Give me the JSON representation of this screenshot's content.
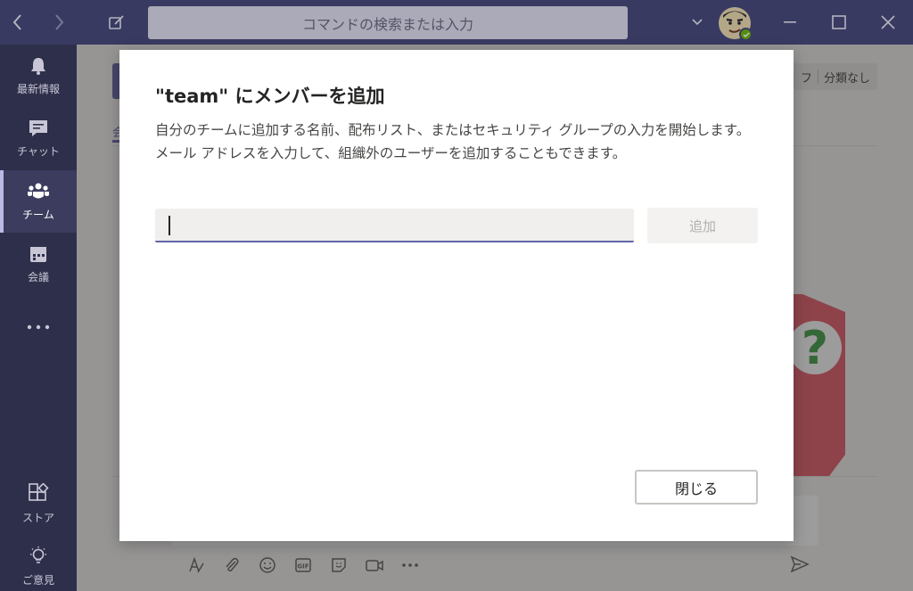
{
  "titlebar": {
    "search_placeholder": "コマンドの検索または入力",
    "icons": [
      "back-arrow-icon",
      "forward-arrow-icon",
      "compose-icon",
      "chevron-down-icon",
      "minimize-icon",
      "maximize-icon",
      "close-icon"
    ]
  },
  "rail": {
    "items": [
      {
        "label": "最新情報",
        "icon": "bell-icon"
      },
      {
        "label": "チャット",
        "icon": "chat-icon"
      },
      {
        "label": "チーム",
        "icon": "teams-icon",
        "active": true
      },
      {
        "label": "会議",
        "icon": "calendar-icon"
      },
      {
        "label": "",
        "icon": "more-icon"
      },
      {
        "label": "ストア",
        "icon": "store-icon"
      },
      {
        "label": "ご意見",
        "icon": "feedback-icon"
      }
    ]
  },
  "background": {
    "filter_text": "フ",
    "filter_value": "分類なし",
    "tab_label": "会",
    "illus_glyph": "?"
  },
  "dialog": {
    "title": "\"team\" にメンバーを追加",
    "description": "自分のチームに追加する名前、配布リスト、またはセキュリティ グループの入力を開始します。メール アドレスを入力して、組織外のユーザーを追加することもできます。",
    "input_value": "",
    "add_label": "追加",
    "close_label": "閉じる"
  },
  "colors": {
    "titlebar": "#464775",
    "rail": "#2e2f4a",
    "accent": "#6264a7"
  }
}
